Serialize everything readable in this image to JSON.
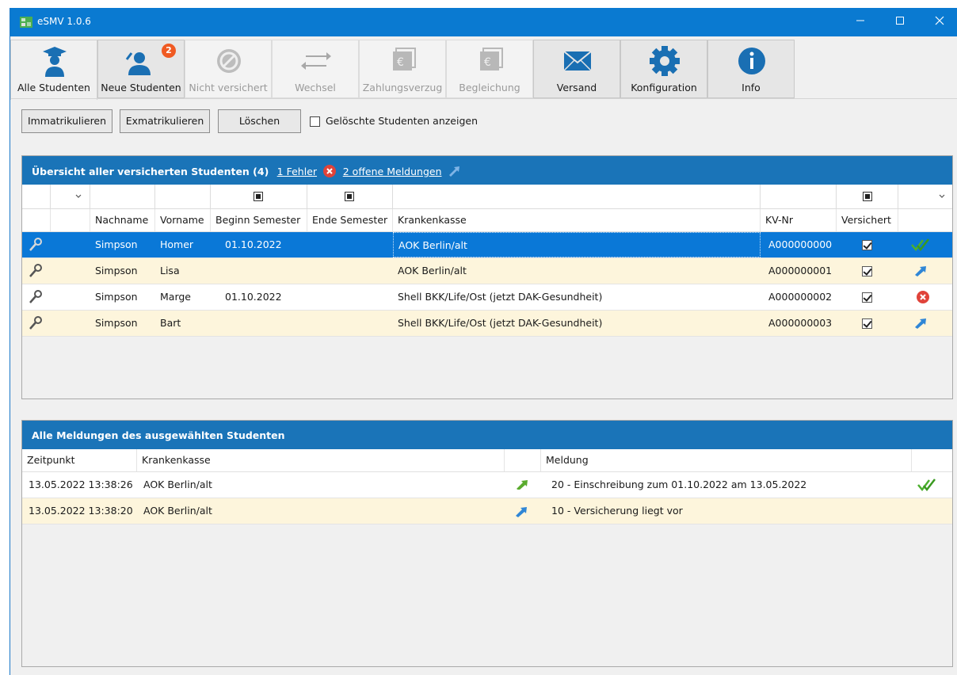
{
  "window": {
    "title": "eSMV 1.0.6",
    "minimize": "—",
    "maximize": "☐",
    "close": "✕"
  },
  "toolbar": {
    "items": [
      {
        "label": "Alle Studenten"
      },
      {
        "label": "Neue Studenten",
        "badge": "2"
      },
      {
        "label": "Nicht versichert"
      },
      {
        "label": "Wechsel"
      },
      {
        "label": "Zahlungsverzug"
      },
      {
        "label": "Begleichung"
      },
      {
        "label": "Versand"
      },
      {
        "label": "Konfiguration"
      },
      {
        "label": "Info"
      }
    ]
  },
  "actions": {
    "immatrikulieren": "Immatrikulieren",
    "exmatrikulieren": "Exmatrikulieren",
    "loeschen": "Löschen",
    "show_deleted_label": "Gelöschte Studenten anzeigen",
    "show_deleted_checked": false
  },
  "students_panel": {
    "title": "Übersicht aller versicherten Studenten (4)",
    "errors_link": "1 Fehler",
    "open_link": "2 offene Meldungen",
    "columns": [
      "Nachname",
      "Vorname",
      "Beginn Semester",
      "Ende Semester",
      "Krankenkasse",
      "KV-Nr",
      "Versichert"
    ],
    "rows": [
      {
        "nachname": "Simpson",
        "vorname": "Homer",
        "beginn": "01.10.2022",
        "ende": "",
        "kasse": "AOK Berlin/alt",
        "kvnr": "A000000000",
        "versichert": true,
        "status": "double-check-icon"
      },
      {
        "nachname": "Simpson",
        "vorname": "Lisa",
        "beginn": "",
        "ende": "",
        "kasse": "AOK Berlin/alt",
        "kvnr": "A000000001",
        "versichert": true,
        "status": "send-arrow-icon"
      },
      {
        "nachname": "Simpson",
        "vorname": "Marge",
        "beginn": "01.10.2022",
        "ende": "",
        "kasse": "Shell BKK/Life/Ost (jetzt DAK-Gesundheit)",
        "kvnr": "A000000002",
        "versichert": true,
        "status": "error-icon"
      },
      {
        "nachname": "Simpson",
        "vorname": "Bart",
        "beginn": "",
        "ende": "",
        "kasse": "Shell BKK/Life/Ost (jetzt DAK-Gesundheit)",
        "kvnr": "A000000003",
        "versichert": true,
        "status": "send-arrow-icon"
      }
    ]
  },
  "messages_panel": {
    "title": "Alle Meldungen des ausgewählten Studenten",
    "columns": [
      "Zeitpunkt",
      "Krankenkasse",
      "Meldung"
    ],
    "rows": [
      {
        "zeitpunkt": "13.05.2022 13:38:26",
        "kasse": "AOK Berlin/alt",
        "meldung": "20 - Einschreibung zum 01.10.2022 am 13.05.2022",
        "direction": "outgoing-arrow-icon",
        "status": "double-check-icon"
      },
      {
        "zeitpunkt": "13.05.2022 13:38:20",
        "kasse": "AOK Berlin/alt",
        "meldung": "10 - Versicherung liegt vor",
        "direction": "incoming-arrow-icon",
        "status": ""
      }
    ]
  },
  "colors": {
    "title_bar": "#0a7ad1",
    "panel_header": "#1a74b8",
    "selection": "#0a78d7",
    "alt_row": "#fdf5dc",
    "badge": "#f05a22",
    "error": "#e0433a",
    "ok_check": "#3fa02a"
  }
}
